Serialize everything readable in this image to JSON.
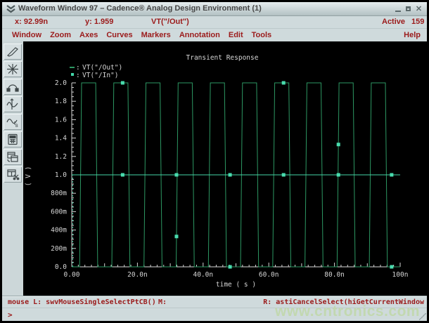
{
  "window": {
    "title": "Waveform Window 97 – Cadence® Analog Design Environment (1)",
    "controls": [
      "minimize-icon",
      "maximize-icon",
      "close-icon"
    ],
    "close_glyph": "✕"
  },
  "readout": {
    "x_text": "x: 92.99n",
    "y_text": "y: 1.959",
    "trace_text": "VT(\"/Out\")",
    "active_label": "Active",
    "active_value": "159"
  },
  "menubar": {
    "items": [
      "Window",
      "Zoom",
      "Axes",
      "Curves",
      "Markers",
      "Annotation",
      "Edit",
      "Tools"
    ],
    "help": "Help"
  },
  "toolbar": {
    "icons": [
      "probe-pen-icon",
      "zoom-star-icon",
      "arc-marker-icon",
      "vert-marker-icon",
      "wave-b-marker-icon",
      "calculator-icon",
      "copy-window-icon",
      "cut-window-icon"
    ]
  },
  "chart_data": {
    "type": "line",
    "title": "Transient Response",
    "xlabel": "time ( s )",
    "ylabel": "( V )",
    "xlim": [
      0,
      100
    ],
    "ylim": [
      0,
      2
    ],
    "x_unit": "ns",
    "grid": false,
    "legend_position": "top-left",
    "axis_color": "#d6d6d6",
    "marker_color": "#49dcae",
    "x_tick_labels": [
      "0.00",
      "20.0n",
      "40.0n",
      "60.0n",
      "80.0n",
      "100n"
    ],
    "x_major_step": 20,
    "x_medium_step": 10,
    "x_minor_step": 2,
    "y_tick_labels": [
      "0.0",
      "200m",
      "400m",
      "600m",
      "800m",
      "1.0",
      "1.2",
      "1.4",
      "1.6",
      "1.8",
      "2.0"
    ],
    "y_major_step": 0.2,
    "y_minor_step": 0.05,
    "legend": [
      {
        "symbol": "dash",
        "label": "VT(\"/Out\")",
        "color": "#2d9863"
      },
      {
        "symbol": "square",
        "label": "VT(\"/In\")",
        "color": "#43d6a9"
      }
    ],
    "series": [
      {
        "name": "out",
        "color": "#2d9863",
        "points": [
          [
            0,
            0
          ],
          [
            2.4,
            0
          ],
          [
            3.0,
            2
          ],
          [
            7.3,
            2
          ],
          [
            7.9,
            0
          ],
          [
            12.2,
            0
          ],
          [
            12.8,
            2
          ],
          [
            17.1,
            2
          ],
          [
            17.7,
            0
          ],
          [
            22.0,
            0
          ],
          [
            22.6,
            2
          ],
          [
            26.9,
            2
          ],
          [
            27.5,
            0
          ],
          [
            31.8,
            0
          ],
          [
            32.4,
            2
          ],
          [
            36.7,
            2
          ],
          [
            37.3,
            0
          ],
          [
            41.6,
            0
          ],
          [
            42.2,
            2
          ],
          [
            46.5,
            2
          ],
          [
            47.1,
            0
          ],
          [
            51.4,
            0
          ],
          [
            52.0,
            2
          ],
          [
            56.3,
            2
          ],
          [
            56.9,
            0
          ],
          [
            61.2,
            0
          ],
          [
            61.8,
            2
          ],
          [
            66.1,
            2
          ],
          [
            66.7,
            0
          ],
          [
            71.0,
            0
          ],
          [
            71.6,
            2
          ],
          [
            75.9,
            2
          ],
          [
            76.5,
            0
          ],
          [
            80.8,
            0
          ],
          [
            81.4,
            2
          ],
          [
            85.7,
            2
          ],
          [
            86.3,
            0
          ],
          [
            90.6,
            0
          ],
          [
            91.2,
            2
          ],
          [
            95.5,
            2
          ],
          [
            96.1,
            0
          ],
          [
            100,
            0
          ]
        ],
        "markers": [
          [
            15.5,
            2
          ],
          [
            31.9,
            0.33
          ],
          [
            48.2,
            0
          ],
          [
            64.5,
            2
          ],
          [
            81.2,
            1.33
          ],
          [
            97.4,
            0
          ]
        ]
      },
      {
        "name": "in-initial",
        "color": "#43d6a9",
        "dash": "2,3",
        "points": [
          [
            0.3,
            0
          ],
          [
            0.3,
            1
          ]
        ],
        "markers": []
      },
      {
        "name": "in",
        "color": "#43d6a9",
        "points": [
          [
            0,
            1
          ],
          [
            100,
            1
          ]
        ],
        "markers": [
          [
            15.5,
            1
          ],
          [
            31.9,
            1
          ],
          [
            48.2,
            1
          ],
          [
            64.5,
            1
          ],
          [
            81.2,
            1
          ],
          [
            97.4,
            1
          ]
        ]
      }
    ]
  },
  "statusbar": {
    "mouse_text": "mouse L: swvMouseSingleSelectPtCB()",
    "middle_text": "M:",
    "right_text": "R: astiCancelSelect(hiGetCurrentWindow"
  },
  "prompt": {
    "symbol": ">"
  },
  "watermark": {
    "text": "www.cntronics.com",
    "color": "#c1d8ad"
  }
}
